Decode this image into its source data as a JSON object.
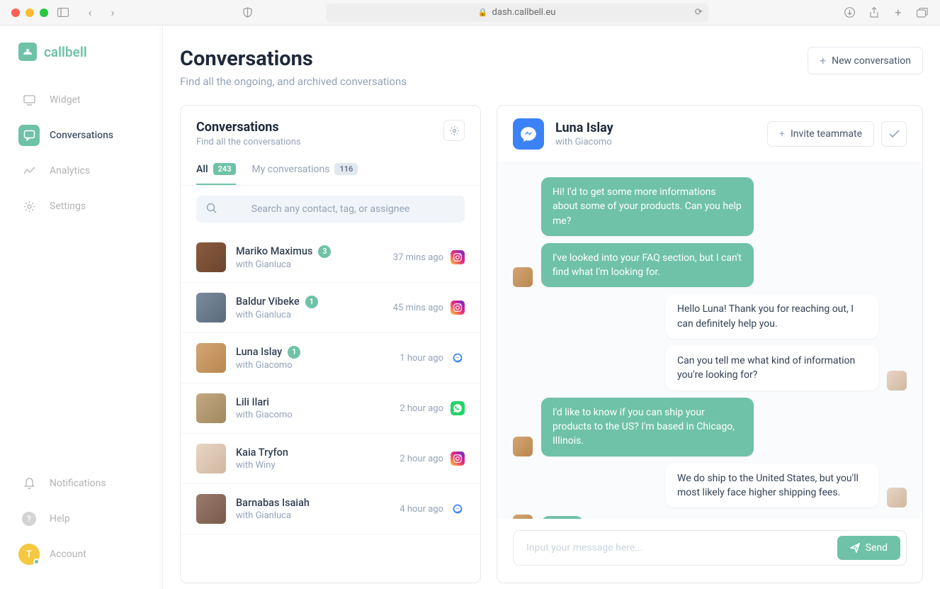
{
  "browser": {
    "url": "dash.callbell.eu"
  },
  "brand": {
    "name": "callbell"
  },
  "sidebar": {
    "items": [
      {
        "label": "Widget"
      },
      {
        "label": "Conversations"
      },
      {
        "label": "Analytics"
      },
      {
        "label": "Settings"
      }
    ],
    "bottom": [
      {
        "label": "Notifications"
      },
      {
        "label": "Help"
      },
      {
        "label": "Account",
        "initial": "T"
      }
    ]
  },
  "header": {
    "title": "Conversations",
    "subtitle": "Find all the ongoing, and archived conversations",
    "new_btn": "New conversation"
  },
  "conv_panel": {
    "title": "Conversations",
    "subtitle": "Find all the conversations",
    "tabs": {
      "all": {
        "label": "All",
        "count": "243"
      },
      "mine": {
        "label": "My conversations",
        "count": "116"
      }
    },
    "search_placeholder": "Search any contact, tag, or assignee",
    "items": [
      {
        "name": "Mariko Maximus",
        "with": "with Gianluca",
        "count": "3",
        "time": "37 mins ago",
        "channel": "instagram",
        "av": "av1"
      },
      {
        "name": "Baldur Vibeke",
        "with": "with Gianluca",
        "count": "1",
        "time": "45 mins ago",
        "channel": "instagram",
        "av": "av2"
      },
      {
        "name": "Luna Islay",
        "with": "with Giacomo",
        "count": "1",
        "time": "1 hour ago",
        "channel": "messenger",
        "av": "av3"
      },
      {
        "name": "Lili Ilari",
        "with": "with Giacomo",
        "count": "",
        "time": "2 hour ago",
        "channel": "whatsapp",
        "av": "av4"
      },
      {
        "name": "Kaia Tryfon",
        "with": "with Winy",
        "count": "",
        "time": "2 hour ago",
        "channel": "instagram",
        "av": "av5"
      },
      {
        "name": "Barnabas Isaiah",
        "with": "with Gianluca",
        "count": "",
        "time": "4 hour ago",
        "channel": "messenger",
        "av": "av6"
      }
    ]
  },
  "chat": {
    "name": "Luna Islay",
    "with": "with Giacomo",
    "invite_btn": "Invite teammate",
    "messages": [
      {
        "side": "left",
        "text": "Hi! I'd to get some more informations about some of your products. Can you help me?",
        "av": false
      },
      {
        "side": "left",
        "text": "I've looked into your FAQ section, but I can't find what I'm looking for.",
        "av": true
      },
      {
        "side": "right",
        "text": "Hello Luna! Thank you for reaching out, I can definitely help you.",
        "av": false
      },
      {
        "side": "right",
        "text": "Can you tell me what kind of information you're looking for?",
        "av": true
      },
      {
        "side": "left",
        "text": "I'd like to know if you can ship your products to the US? I'm based in Chicago, Illinois.",
        "av": true
      },
      {
        "side": "right",
        "text": "We do ship to the United States, but you'll most likely face higher shipping fees.",
        "av": true
      }
    ],
    "composer_placeholder": "Input your message here...",
    "send_label": "Send"
  }
}
